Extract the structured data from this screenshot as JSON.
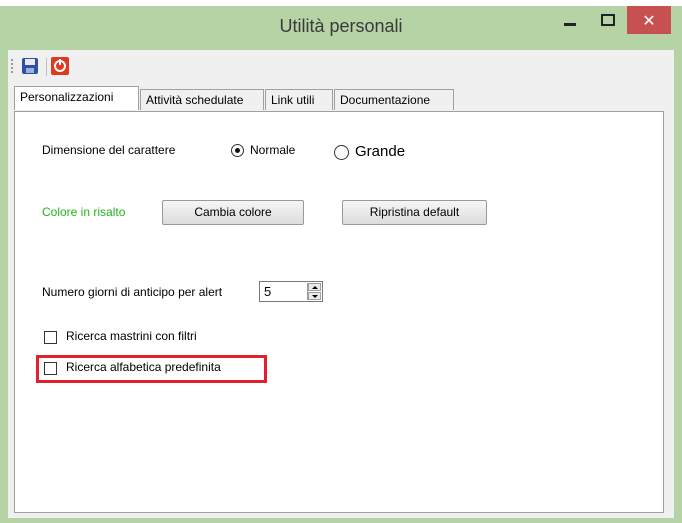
{
  "window": {
    "title": "Utilità personali",
    "close_glyph": "✕"
  },
  "toolbar": {
    "icons": [
      "save-icon",
      "power-icon"
    ]
  },
  "tabs": [
    {
      "label": "Personalizzazioni",
      "active": true
    },
    {
      "label": "Attività schedulate",
      "active": false
    },
    {
      "label": "Link utili",
      "active": false
    },
    {
      "label": "Documentazione",
      "active": false
    }
  ],
  "font_size": {
    "label": "Dimensione del carattere",
    "options": [
      {
        "label": "Normale",
        "checked": true
      },
      {
        "label": "Grande",
        "checked": false
      }
    ]
  },
  "accent": {
    "label": "Colore in risalto",
    "label_color": "#22b41c",
    "change_button": "Cambia colore",
    "reset_button": "Ripristina default"
  },
  "alert_days": {
    "label": "Numero giorni di anticipo per alert",
    "value": "5"
  },
  "checkboxes": [
    {
      "label": "Ricerca mastrini con filtri",
      "checked": false
    },
    {
      "label": "Ricerca alfabetica predefinita",
      "checked": false
    }
  ],
  "highlight_color": "#e0202a"
}
